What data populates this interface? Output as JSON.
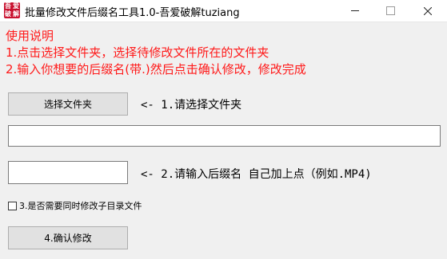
{
  "window": {
    "title": "批量修改文件后缀名工具1.0-吾爱破解tuziang",
    "icon_text": [
      "吾",
      "爱",
      "破",
      "解"
    ],
    "min_symbol": "—",
    "close_symbol": "✕"
  },
  "instructions": {
    "line1": "使用说明",
    "line2": "1.点击选择文件夹，选择待修改文件所在的文件夹",
    "line3": "2.输入你想要的后缀名(带.)然后点击确认修改，修改完成"
  },
  "choose_folder": {
    "button_label": "选择文件夹",
    "hint": "<- 1.请选择文件夹"
  },
  "path_field": {
    "value": ""
  },
  "suffix": {
    "value": "",
    "hint": "<- 2.请输入后缀名 自己加上点（例如.MP4)"
  },
  "subdir_option": {
    "label": "3.是否需要同时修改子目录文件",
    "checked": false
  },
  "confirm": {
    "button_label": "4.确认修改"
  },
  "colors": {
    "instruction_text": "#ff1a1a",
    "button_bg": "#e1e1e1",
    "window_bg": "#f0f0f0"
  }
}
